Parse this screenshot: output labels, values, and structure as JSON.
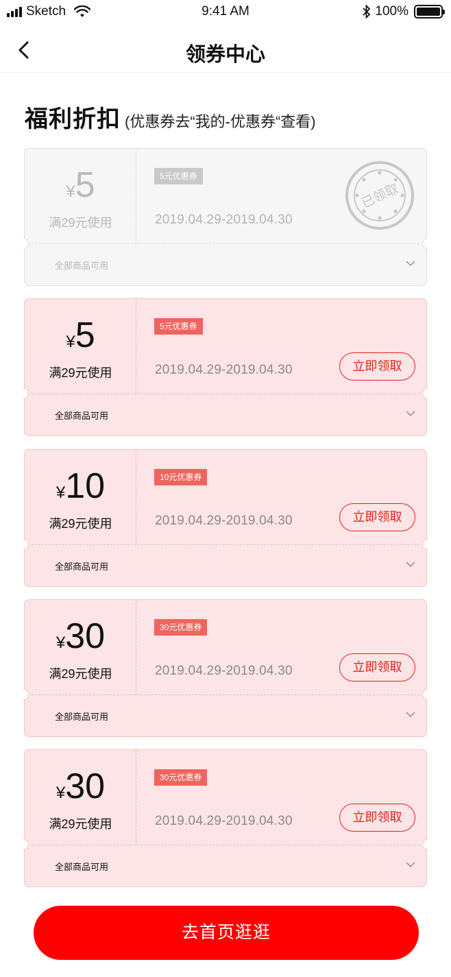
{
  "status_bar": {
    "carrier": "Sketch",
    "time": "9:41 AM",
    "battery": "100%"
  },
  "nav": {
    "title": "领券中心",
    "back_icon": "chevron-left-icon"
  },
  "section": {
    "title": "福利折扣",
    "hint": "(优惠券去“我的-优惠券“查看)"
  },
  "coupons": [
    {
      "currency": "¥",
      "amount": "5",
      "condition": "满29元使用",
      "tag": "5元优惠券",
      "date": "2019.04.29-2019.04.30",
      "scope": "全部商品可用",
      "claimed": true,
      "stamp_text": "已领取"
    },
    {
      "currency": "¥",
      "amount": "5",
      "condition": "满29元使用",
      "tag": "5元优惠券",
      "date": "2019.04.29-2019.04.30",
      "scope": "全部商品可用",
      "claimed": false,
      "button": "立即领取"
    },
    {
      "currency": "¥",
      "amount": "10",
      "condition": "满29元使用",
      "tag": "10元优惠券",
      "date": "2019.04.29-2019.04.30",
      "scope": "全部商品可用",
      "claimed": false,
      "button": "立即领取"
    },
    {
      "currency": "¥",
      "amount": "30",
      "condition": "满29元使用",
      "tag": "30元优惠券",
      "date": "2019.04.29-2019.04.30",
      "scope": "全部商品可用",
      "claimed": false,
      "button": "立即领取"
    },
    {
      "currency": "¥",
      "amount": "30",
      "condition": "满29元使用",
      "tag": "30元优惠券",
      "date": "2019.04.29-2019.04.30",
      "scope": "全部商品可用",
      "claimed": false,
      "button": "立即领取"
    }
  ],
  "footer": {
    "button": "去首页逛逛"
  },
  "colors": {
    "accent": "#e2231a",
    "primary_button": "#ff0000",
    "coupon_bg": "#fde4e6",
    "tag_bg": "#f0645f"
  }
}
